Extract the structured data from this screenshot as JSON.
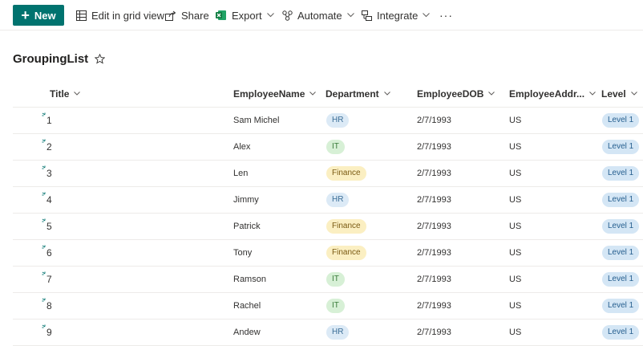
{
  "command_bar": {
    "new_label": "New",
    "edit_grid_label": "Edit in grid view",
    "share_label": "Share",
    "export_label": "Export",
    "automate_label": "Automate",
    "integrate_label": "Integrate",
    "more_label": "···"
  },
  "list": {
    "title": "GroupingList"
  },
  "columns": {
    "title": "Title",
    "employee_name": "EmployeeName",
    "department": "Department",
    "employee_dob": "EmployeeDOB",
    "employee_addr": "EmployeeAddr...",
    "level": "Level"
  },
  "colors": {
    "brand": "#00736f",
    "hr_bg": "#dceaf6",
    "hr_fg": "#3a6d96",
    "it_bg": "#d7f0d6",
    "it_fg": "#3b7c3b",
    "finance_bg": "#fbefc2",
    "finance_fg": "#7a5a12",
    "level_bg": "#d4e6f5",
    "level_fg": "#265f8f"
  },
  "rows": [
    {
      "title": "1",
      "employee_name": "Sam Michel",
      "department": "HR",
      "dob": "2/7/1993",
      "address": "US",
      "level": "Level 1"
    },
    {
      "title": "2",
      "employee_name": "Alex",
      "department": "IT",
      "dob": "2/7/1993",
      "address": "US",
      "level": "Level 1"
    },
    {
      "title": "3",
      "employee_name": "Len",
      "department": "Finance",
      "dob": "2/7/1993",
      "address": "US",
      "level": "Level 1"
    },
    {
      "title": "4",
      "employee_name": "Jimmy",
      "department": "HR",
      "dob": "2/7/1993",
      "address": "US",
      "level": "Level 1"
    },
    {
      "title": "5",
      "employee_name": "Patrick",
      "department": "Finance",
      "dob": "2/7/1993",
      "address": "US",
      "level": "Level 1"
    },
    {
      "title": "6",
      "employee_name": "Tony",
      "department": "Finance",
      "dob": "2/7/1993",
      "address": "US",
      "level": "Level 1"
    },
    {
      "title": "7",
      "employee_name": "Ramson",
      "department": "IT",
      "dob": "2/7/1993",
      "address": "US",
      "level": "Level 1"
    },
    {
      "title": "8",
      "employee_name": "Rachel",
      "department": "IT",
      "dob": "2/7/1993",
      "address": "US",
      "level": "Level 1"
    },
    {
      "title": "9",
      "employee_name": "Andew",
      "department": "HR",
      "dob": "2/7/1993",
      "address": "US",
      "level": "Level 1"
    }
  ]
}
